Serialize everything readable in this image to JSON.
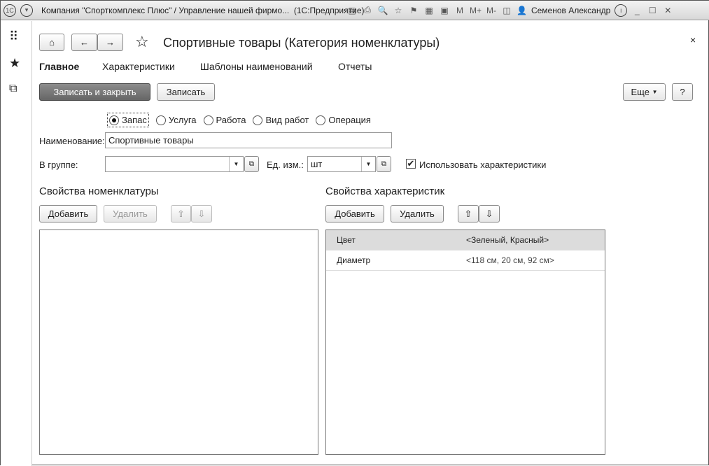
{
  "window": {
    "title": "Компания \"Спорткомплекс Плюс\" / Управление нашей фирмо...  (1С:Предприятие)",
    "user": "Семенов Александр",
    "m": "M",
    "mplus": "M+",
    "mminus": "M-"
  },
  "form": {
    "title": "Спортивные товары (Категория номенклатуры)",
    "tabs": [
      "Главное",
      "Характеристики",
      "Шаблоны наименований",
      "Отчеты"
    ],
    "buttons": {
      "save_close": "Записать и закрыть",
      "save": "Записать",
      "more": "Еще",
      "help": "?"
    },
    "types": [
      {
        "label": "Запас",
        "selected": true
      },
      {
        "label": "Услуга",
        "selected": false
      },
      {
        "label": "Работа",
        "selected": false
      },
      {
        "label": "Вид работ",
        "selected": false
      },
      {
        "label": "Операция",
        "selected": false
      }
    ],
    "name_label": "Наименование:",
    "name_value": "Спортивные товары",
    "group_label": "В группе:",
    "group_value": "",
    "unit_label": "Ед. изм.:",
    "unit_value": "шт",
    "use_chars_label": "Использовать характеристики",
    "use_chars_checked": true,
    "props_title": "Свойства номенклатуры",
    "chars_title": "Свойства характеристик",
    "add": "Добавить",
    "delete": "Удалить",
    "chars_rows": [
      {
        "name": "Цвет",
        "values": "<Зеленый, Красный>"
      },
      {
        "name": "Диаметр",
        "values": "<118 см, 20 см, 92 см>"
      }
    ]
  }
}
